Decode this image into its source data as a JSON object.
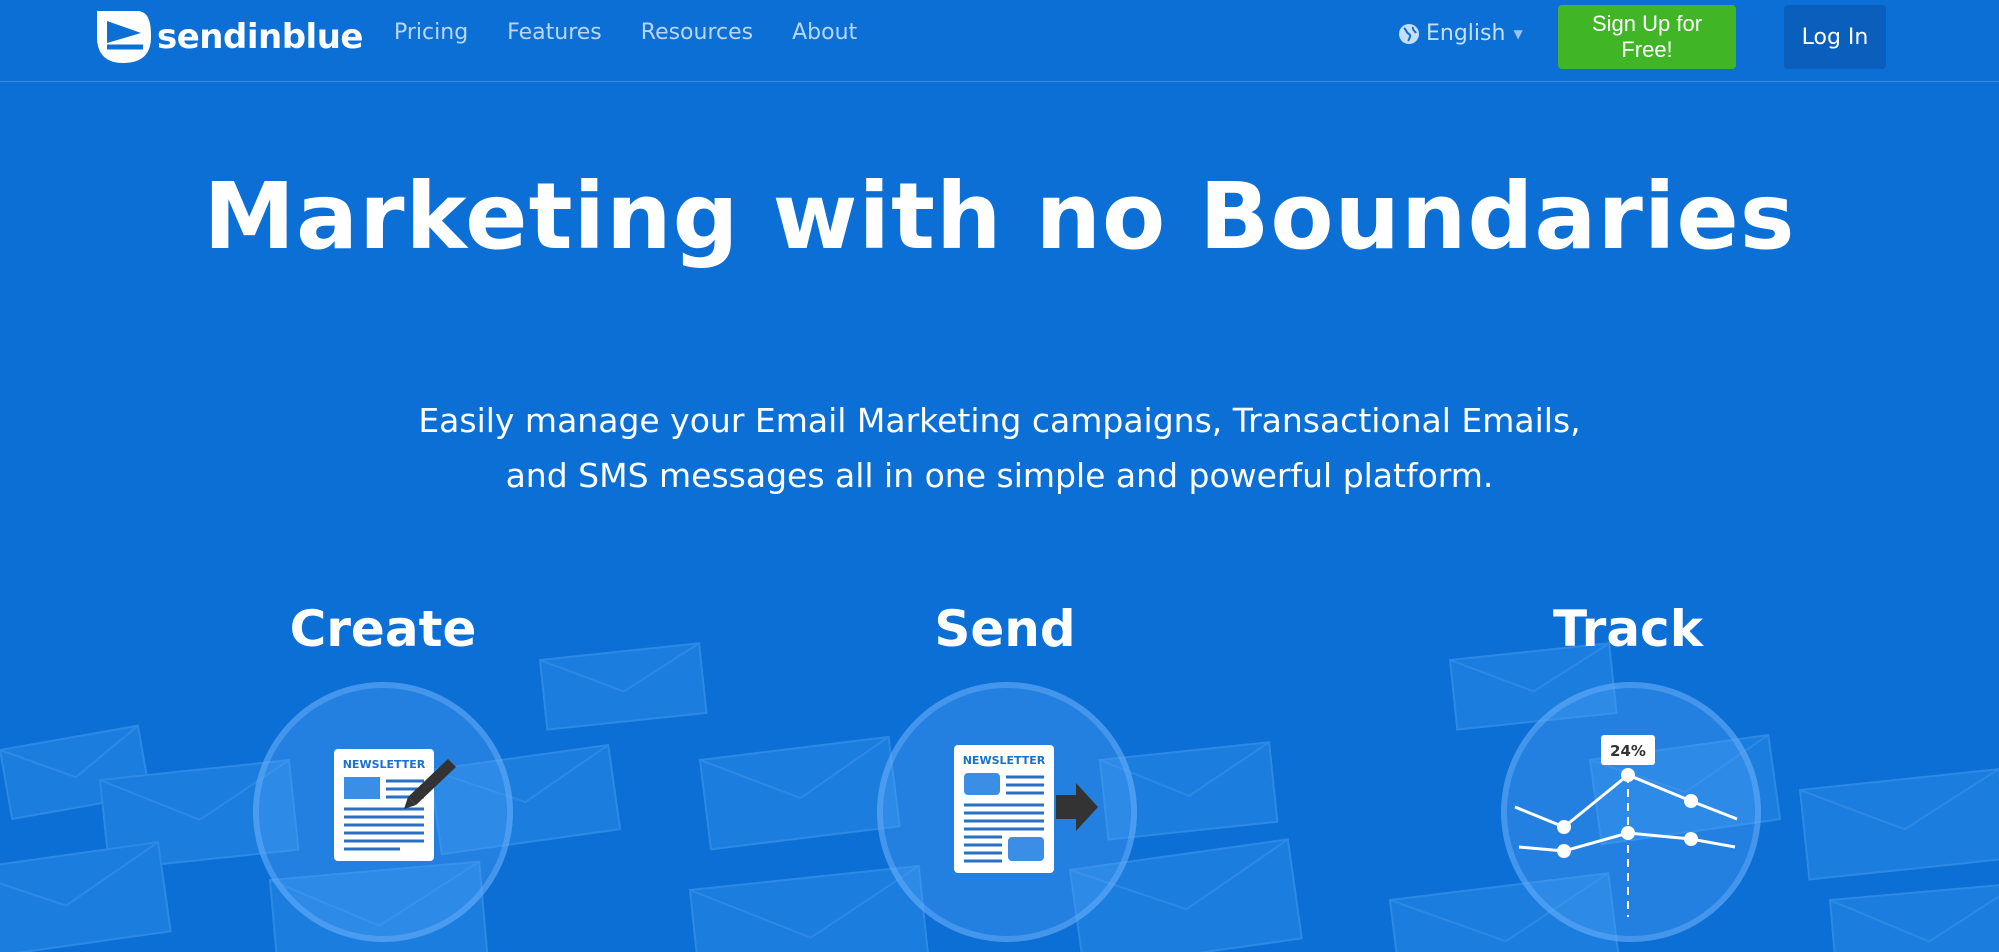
{
  "brand": {
    "name": "sendinblue"
  },
  "nav": {
    "items": [
      {
        "label": "Pricing"
      },
      {
        "label": "Features"
      },
      {
        "label": "Resources"
      },
      {
        "label": "About"
      }
    ]
  },
  "language": {
    "label": "English"
  },
  "actions": {
    "signup": "Sign Up for Free!",
    "login": "Log In"
  },
  "hero": {
    "title": "Marketing with no Boundaries",
    "subtitle_line1": "Easily manage your Email Marketing campaigns, Transactional Emails,",
    "subtitle_line2": "and SMS messages all in one simple and powerful platform."
  },
  "features": [
    {
      "title": "Create",
      "icon": "newsletter-pen-icon",
      "doc_label": "NEWSLETTER"
    },
    {
      "title": "Send",
      "icon": "newsletter-arrow-icon",
      "doc_label": "NEWSLETTER"
    },
    {
      "title": "Track",
      "icon": "chart-icon",
      "stat": "24%"
    }
  ],
  "colors": {
    "background": "#0b6fd6",
    "signup": "#40b627",
    "login": "#0a5fbd"
  }
}
